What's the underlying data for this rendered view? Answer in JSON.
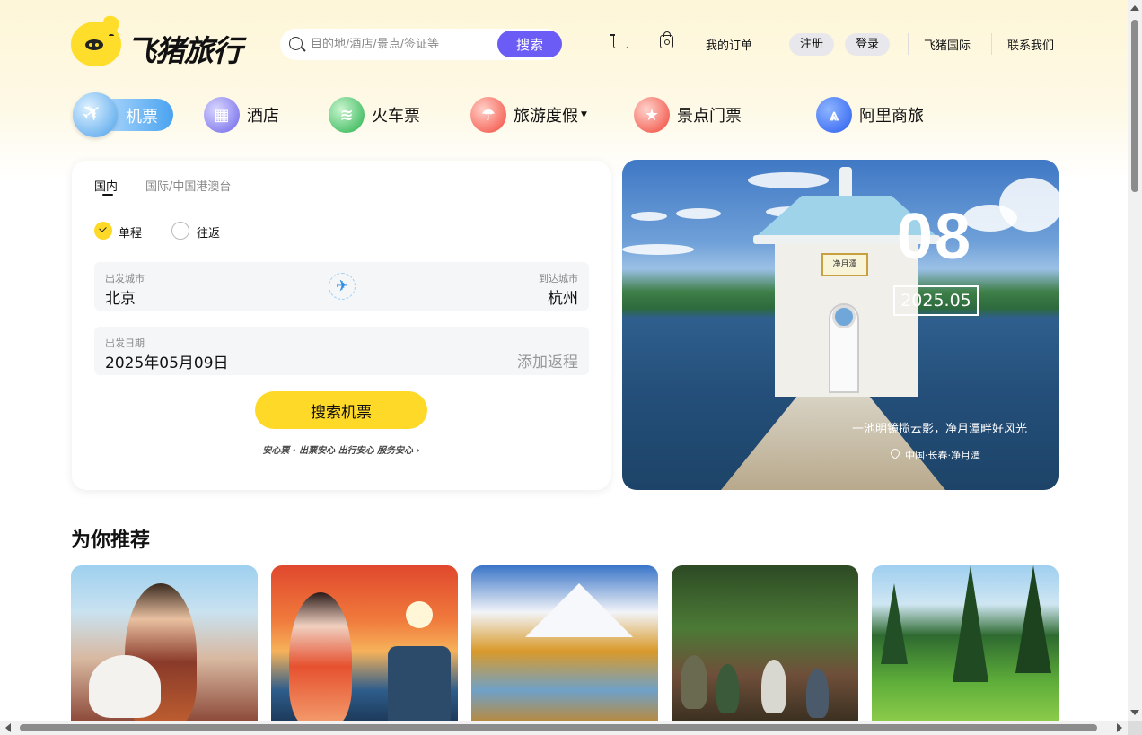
{
  "header": {
    "logo_text": "飞猪旅行",
    "search_placeholder": "目的地/酒店/景点/签证等",
    "search_button": "搜索",
    "cart_icon": "cart-icon",
    "bag_icon": "bag-icon",
    "my_orders": "我的订单",
    "register": "注册",
    "login": "登录",
    "international": "飞猪国际",
    "contact": "联系我们"
  },
  "categories": [
    {
      "label": "机票",
      "icon": "plane-icon",
      "active": true
    },
    {
      "label": "酒店",
      "icon": "hotel-icon"
    },
    {
      "label": "火车票",
      "icon": "train-icon"
    },
    {
      "label": "旅游度假",
      "icon": "vacation-icon",
      "has_dropdown": true
    },
    {
      "label": "景点门票",
      "icon": "ticket-icon"
    },
    {
      "label": "阿里商旅",
      "icon": "alibiz-icon"
    }
  ],
  "booking": {
    "tabs": [
      "国内",
      "国际/中国港澳台"
    ],
    "trip_types": [
      {
        "label": "单程",
        "checked": true
      },
      {
        "label": "往返",
        "checked": false
      }
    ],
    "departure_label": "出发城市",
    "departure_value": "北京",
    "arrival_label": "到达城市",
    "arrival_value": "杭州",
    "date_label": "出发日期",
    "date_value": "2025年05月09日",
    "add_return": "添加返程",
    "search_button": "搜索机票",
    "assurance": "安心票 · 出票安心 出行安心 服务安心 ›"
  },
  "promo": {
    "day": "08",
    "month": "2025.05",
    "caption": "一池明镜揽云影，净月潭畔好风光",
    "location": "中国·长春·净月潭",
    "sign_text": "净月潭"
  },
  "recommend": {
    "title": "为你推荐",
    "cards": [
      "card-1",
      "card-2",
      "card-3",
      "card-4",
      "card-5"
    ]
  },
  "colors": {
    "accent_yellow": "#ffd928",
    "search_purple": "#6b5cf5",
    "flight_blue": "#4aa3f0"
  }
}
